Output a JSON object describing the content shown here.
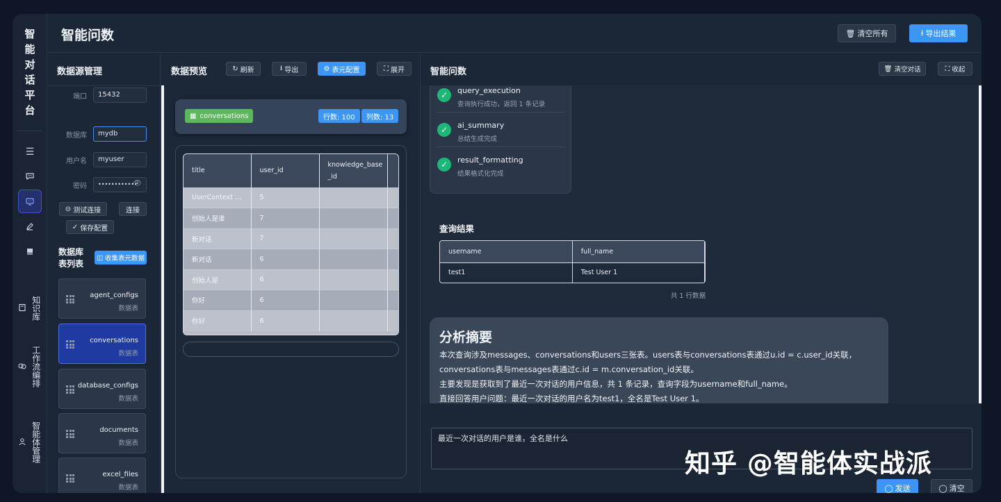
{
  "app": {
    "brand_chars": [
      "智",
      "能",
      "对",
      "话",
      "平",
      "台"
    ],
    "title": "智能问数",
    "clear_all": "清空所有",
    "export_results": "导出结果"
  },
  "rail": {
    "icons": [
      "menu-icon",
      "chat-icon",
      "monitor-icon",
      "edit-icon",
      "storage-icon"
    ],
    "nav": [
      {
        "label": "知识库",
        "icon": "book-icon"
      },
      {
        "label": "工作流编排",
        "icon": "workflow-icon"
      },
      {
        "label": "智能体管理",
        "icon": "user-icon"
      }
    ]
  },
  "datasource": {
    "title": "数据源管理",
    "port_label": "端口",
    "port": "15432",
    "db_label": "数据库",
    "db": "mydb",
    "user_label": "用户名",
    "user": "myuser",
    "pwd_label": "密码",
    "pwd": "••••••••••••",
    "test_btn": "测试连接",
    "connect_btn": "连接",
    "save_btn": "保存配置",
    "tables_title_1": "数据库",
    "tables_title_2": "表列表",
    "collect_btn": "收集表元数据",
    "tables": [
      {
        "name": "agent_configs",
        "type": "数据表"
      },
      {
        "name": "conversations",
        "type": "数据表"
      },
      {
        "name": "database_configs",
        "type": "数据表"
      },
      {
        "name": "documents",
        "type": "数据表"
      },
      {
        "name": "excel_files",
        "type": "数据表"
      }
    ]
  },
  "preview": {
    "title": "数据预览",
    "refresh": "刷新",
    "export": "导出",
    "meta_config": "表元配置",
    "expand": "展开",
    "table_name": "conversations",
    "rows_badge": "行数: 100",
    "cols_badge": "列数: 13",
    "columns": [
      "title",
      "user_id",
      "knowledge_base_id",
      ""
    ],
    "col3_l1": "knowledge_base",
    "col3_l2": "_id",
    "rows": [
      [
        "UserContext Test ...",
        "5"
      ],
      [
        "创始人是谁",
        "7"
      ],
      [
        "新对话",
        "7"
      ],
      [
        "新对话",
        "6"
      ],
      [
        "创始人是",
        "6"
      ],
      [
        "你好",
        "6"
      ],
      [
        "你好",
        "6"
      ]
    ]
  },
  "qa": {
    "title": "智能问数",
    "clear_chat": "清空对话",
    "collapse": "收起",
    "steps": [
      {
        "name": "query_execution",
        "desc": "查询执行成功，返回 1 条记录"
      },
      {
        "name": "ai_summary",
        "desc": "总结生成完成"
      },
      {
        "name": "result_formatting",
        "desc": "结果格式化完成"
      }
    ],
    "result_title": "查询结果",
    "result_columns": [
      "username",
      "full_name"
    ],
    "result_rows": [
      [
        "test1",
        "Test User 1"
      ]
    ],
    "result_count": "共 1 行数据",
    "summary_title": "分析摘要",
    "summary_lines": [
      "本次查询涉及messages、conversations和users三张表。users表与conversations表通过u.id = c.user_id关联，",
      "conversations表与messages表通过c.id = m.conversation_id关联。",
      "主要发现是获取到了最近一次对话的用户信息，共 1 条记录，查询字段为username和full_name。",
      "直接回答用户问题：最近一次对话的用户名为test1，全名是Test User 1。"
    ],
    "input_value": "最近一次对话的用户是谁，全名是什么",
    "send": "发送",
    "clear": "清空"
  },
  "watermark": "知乎 @智能体实战派"
}
